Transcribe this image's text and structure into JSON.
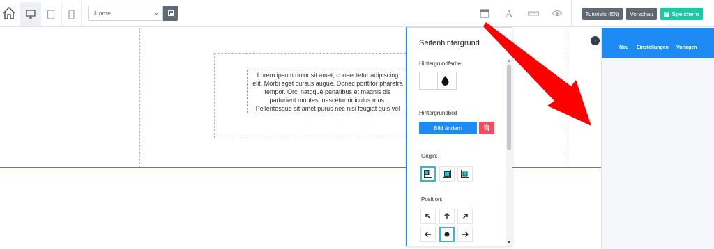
{
  "toolbar": {
    "page_select_value": "Home",
    "tutorials_label": "Tutorials (EN)",
    "preview_label": "Vorschau",
    "save_label": "Speichern"
  },
  "canvas": {
    "lorem_text": "Lorem ipsum dolor sit amet, consectetur adipiscing elit. Morbi eget cursus augue. Donec porttitor pharetra tempor. Orci natoque penatibus et magnis dis parturient montes, nascetur ridiculus mus. Pellentesque sit amet purus nec nisi feugiat quis vel felis."
  },
  "panel": {
    "title": "Seitenhintergrund",
    "bg_color_label": "Hintergrundfarbe",
    "bg_image_label": "Hintergrundbild",
    "change_image_label": "Bild ändern",
    "origin_label": "Origin:",
    "position_label": "Position:"
  },
  "sidebar": {
    "tabs": [
      "Neu",
      "Einstellungen",
      "Vorlagen"
    ]
  },
  "colors": {
    "accent_blue": "#1e8bf5",
    "save_green": "#19c9a3",
    "delete_red": "#f04e5e",
    "selected_cyan": "#1ec4d8",
    "annotation_red": "#ff0000"
  }
}
